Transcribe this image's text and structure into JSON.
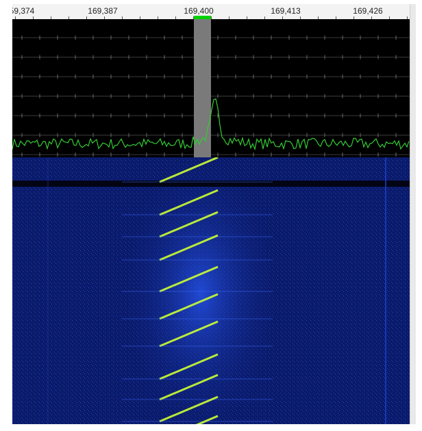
{
  "ruler": {
    "labels": [
      "59,374",
      "169,387",
      "169,400",
      "169,413",
      "169,426"
    ]
  },
  "colors": {
    "ruler_bg": "#f3f3f3",
    "spectrum_bg": "#000000",
    "spectrum_trace": "#33cc33",
    "passband": "#7a7a7a",
    "vfo_marker": "#00d200",
    "waterfall_bg": "#0a1a6a",
    "waterfall_signal": "#ccff33"
  }
}
